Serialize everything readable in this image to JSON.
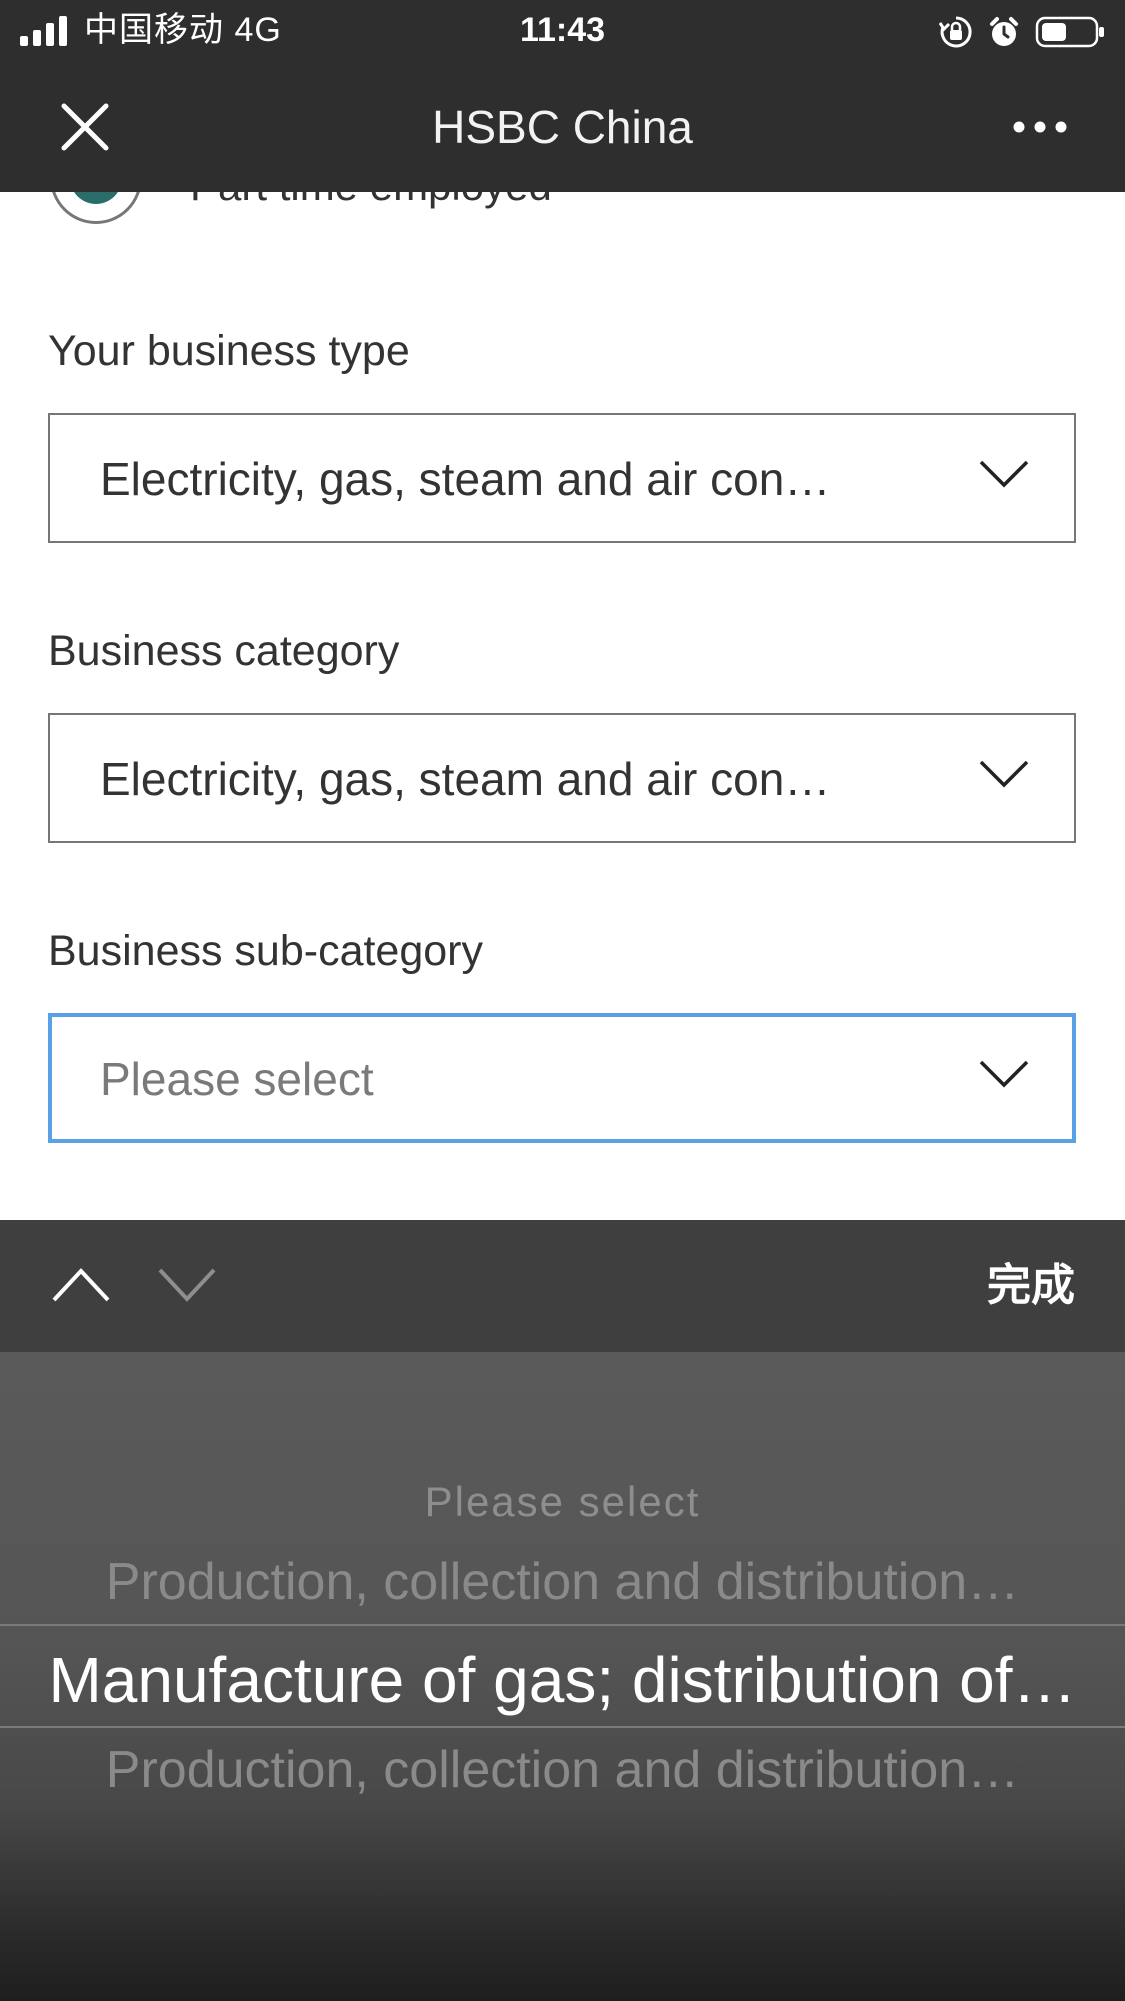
{
  "status_bar": {
    "carrier": "中国移动  4G",
    "time": "11:43",
    "icons": [
      "signal-icon",
      "rotation-lock-icon",
      "alarm-icon",
      "battery-icon"
    ]
  },
  "nav": {
    "title": "HSBC China",
    "close_icon": "close-icon",
    "more_icon": "more-icon"
  },
  "form": {
    "radio_partial_label": "Part time employed",
    "business_type": {
      "label": "Your business type",
      "value": "Electricity, gas, steam and air con…"
    },
    "business_category": {
      "label": "Business category",
      "value": "Electricity, gas, steam and air con…"
    },
    "business_subcategory": {
      "label": "Business sub-category",
      "placeholder": "Please select"
    }
  },
  "toolbar": {
    "done_label": "完成"
  },
  "picker": {
    "options": [
      "Please select",
      "Production, collection and distribution…",
      "Manufacture of gas; distribution of…",
      "Production, collection and distribution…"
    ],
    "selected_index": 2
  },
  "colors": {
    "bar_background": "#2e2e2e",
    "focus_border": "#5aa0e6",
    "radio_fill": "#2a6e6a",
    "toolbar_background": "#3f3f3f"
  }
}
